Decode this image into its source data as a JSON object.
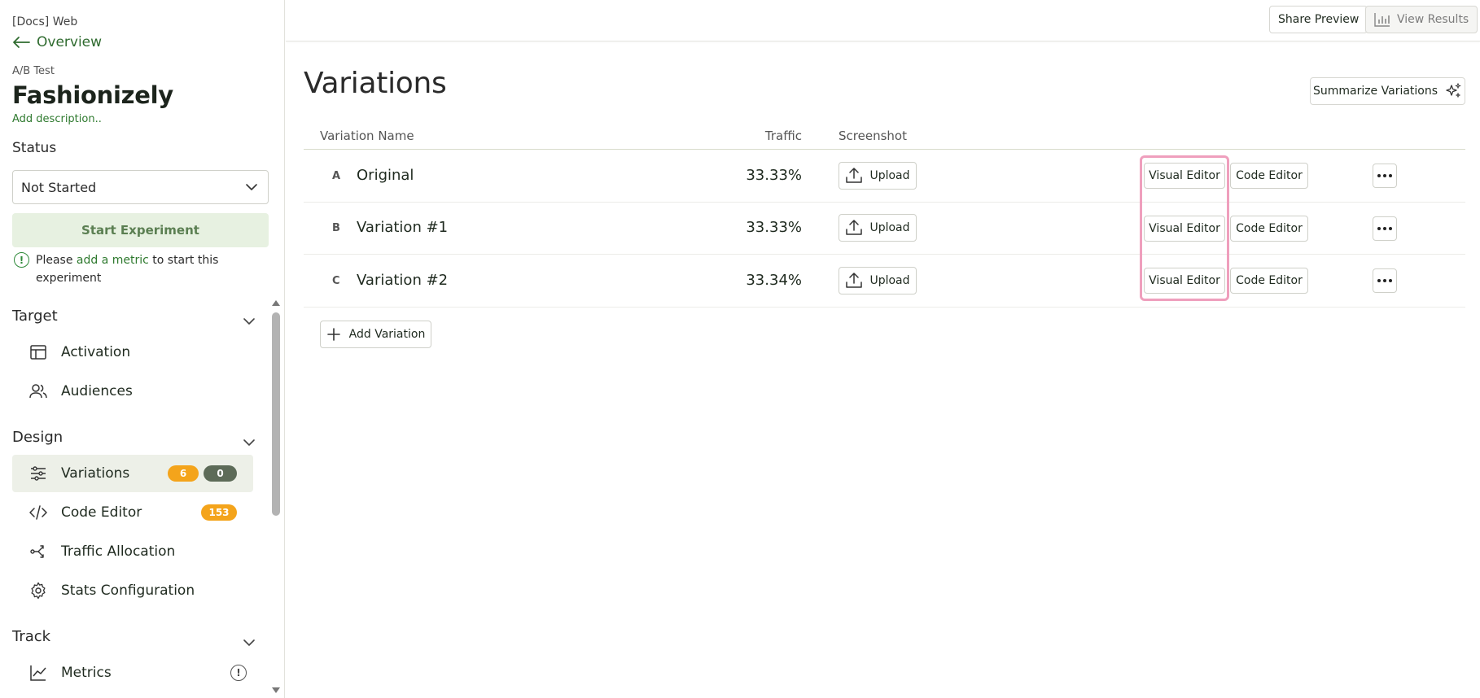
{
  "sidebar": {
    "project": "[Docs] Web",
    "back_label": "Overview",
    "experiment_type": "A/B Test",
    "experiment_name": "Fashionizely",
    "add_description": "Add description..",
    "status_label": "Status",
    "status_value": "Not Started",
    "start_button": "Start Experiment",
    "warning": {
      "prefix": "Please",
      "link": "add a metric",
      "suffix": "to start this experiment"
    },
    "sections": {
      "target": {
        "title": "Target",
        "items": [
          {
            "label": "Activation",
            "icon": "layout-icon"
          },
          {
            "label": "Audiences",
            "icon": "users-icon"
          }
        ]
      },
      "design": {
        "title": "Design",
        "items": [
          {
            "label": "Variations",
            "icon": "sliders-icon",
            "badges": [
              "6",
              "0"
            ]
          },
          {
            "label": "Code Editor",
            "icon": "code-icon",
            "badges": [
              "153"
            ]
          },
          {
            "label": "Traffic Allocation",
            "icon": "split-icon"
          },
          {
            "label": "Stats Configuration",
            "icon": "gear-icon"
          }
        ]
      },
      "track": {
        "title": "Track",
        "items": [
          {
            "label": "Metrics",
            "icon": "chart-line-icon",
            "info": "!"
          }
        ]
      }
    }
  },
  "topbar": {
    "share_preview": "Share Preview",
    "view_results": "View Results"
  },
  "main": {
    "title": "Variations",
    "summarize_button": "Summarize Variations",
    "columns": {
      "name": "Variation Name",
      "traffic": "Traffic",
      "screenshot": "Screenshot"
    },
    "variations": [
      {
        "letter": "A",
        "name": "Original",
        "traffic": "33.33%",
        "upload": "Upload",
        "visual_editor": "Visual Editor",
        "code_editor": "Code Editor"
      },
      {
        "letter": "B",
        "name": "Variation #1",
        "traffic": "33.33%",
        "upload": "Upload",
        "visual_editor": "Visual Editor",
        "code_editor": "Code Editor"
      },
      {
        "letter": "C",
        "name": "Variation #2",
        "traffic": "33.34%",
        "upload": "Upload",
        "visual_editor": "Visual Editor",
        "code_editor": "Code Editor"
      }
    ],
    "add_variation": "Add Variation"
  },
  "colors": {
    "accent_green": "#2f7a2f",
    "active_bg": "#edf0e8",
    "badge_orange": "#f4a41b",
    "badge_gray": "#5d6b58",
    "highlight_pink": "#ef9fbd"
  }
}
